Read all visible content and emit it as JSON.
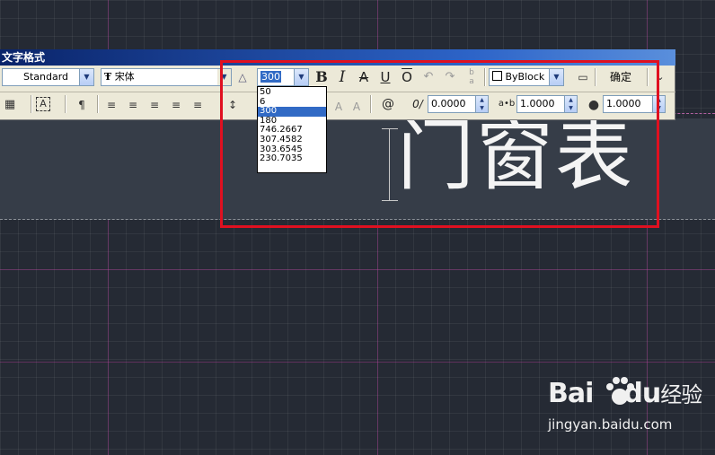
{
  "toolbar": {
    "title": "文字格式",
    "style_value": "Standard",
    "font_value": "宋体",
    "font_prefix_icon": "truetype-icon",
    "height_value": "300",
    "bold_label": "B",
    "italic_label": "I",
    "strike_label": "A",
    "underline_label": "U",
    "overline_label": "O",
    "undo_icon": "undo-icon",
    "redo_icon": "redo-icon",
    "stack_icon": "stack-icon",
    "color_value": "ByBlock",
    "ruler_icon": "ruler-icon",
    "ok_label": "确定",
    "options_icon": "options-icon",
    "row2": {
      "columns_icon": "columns-icon",
      "mtext_justify_icon": "mtext-justification-icon",
      "paragraph_icon": "paragraph-icon",
      "align_left_icon": "align-left-icon",
      "align_center_icon": "align-center-icon",
      "align_right_icon": "align-right-icon",
      "justify_icon": "justify-icon",
      "distribute_icon": "distribute-icon",
      "line_spacing_icon": "line-spacing-icon",
      "uppercase_icon": "uppercase-icon",
      "lowercase_icon": "lowercase-icon",
      "symbol_label": "@",
      "oblique_label": "0/",
      "oblique_value": "0.0000",
      "tracking_label": "a•b",
      "tracking_value": "1.0000",
      "width_factor_value": "1.0000"
    }
  },
  "height_dropdown": {
    "options": [
      "50",
      "6",
      "300",
      "180",
      "746.2667",
      "307.4582",
      "303.6545",
      "230.7035"
    ],
    "selected": "300"
  },
  "canvas": {
    "mtext": "门窗表"
  },
  "watermark": {
    "logo_left": "Bai",
    "logo_right": "du",
    "logo_suffix": "经验",
    "url": "jingyan.baidu.com"
  },
  "colors": {
    "highlight": "#e01020",
    "titlebar": "#0a246a",
    "selection": "#316ac5",
    "canvas_bg": "#252a34"
  }
}
